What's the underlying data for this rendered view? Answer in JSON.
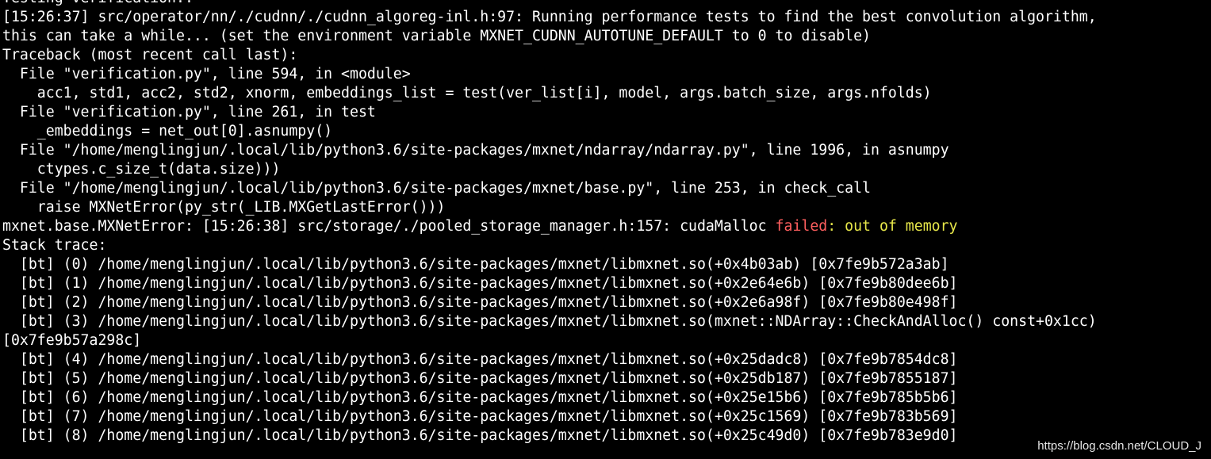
{
  "terminal": {
    "lines": [
      "Testing verification..",
      "[15:26:37] src/operator/nn/./cudnn/./cudnn_algoreg-inl.h:97: Running performance tests to find the best convolution algorithm,",
      "this can take a while... (set the environment variable MXNET_CUDNN_AUTOTUNE_DEFAULT to 0 to disable)",
      "Traceback (most recent call last):",
      "  File \"verification.py\", line 594, in <module>",
      "    acc1, std1, acc2, std2, xnorm, embeddings_list = test(ver_list[i], model, args.batch_size, args.nfolds)",
      "  File \"verification.py\", line 261, in test",
      "    _embeddings = net_out[0].asnumpy()",
      "  File \"/home/menglingjun/.local/lib/python3.6/site-packages/mxnet/ndarray/ndarray.py\", line 1996, in asnumpy",
      "    ctypes.c_size_t(data.size)))",
      "  File \"/home/menglingjun/.local/lib/python3.6/site-packages/mxnet/base.py\", line 253, in check_call",
      "    raise MXNetError(py_str(_LIB.MXGetLastError()))"
    ],
    "error_line": {
      "prefix": "mxnet.base.MXNetError: [15:26:38] src/storage/./pooled_storage_manager.h:157: cudaMalloc ",
      "failed": "failed",
      "suffix": ": out of memory"
    },
    "stack_lines": [
      "Stack trace:",
      "  [bt] (0) /home/menglingjun/.local/lib/python3.6/site-packages/mxnet/libmxnet.so(+0x4b03ab) [0x7fe9b572a3ab]",
      "  [bt] (1) /home/menglingjun/.local/lib/python3.6/site-packages/mxnet/libmxnet.so(+0x2e64e6b) [0x7fe9b80dee6b]",
      "  [bt] (2) /home/menglingjun/.local/lib/python3.6/site-packages/mxnet/libmxnet.so(+0x2e6a98f) [0x7fe9b80e498f]",
      "  [bt] (3) /home/menglingjun/.local/lib/python3.6/site-packages/mxnet/libmxnet.so(mxnet::NDArray::CheckAndAlloc() const+0x1cc)",
      "[0x7fe9b57a298c]",
      "  [bt] (4) /home/menglingjun/.local/lib/python3.6/site-packages/mxnet/libmxnet.so(+0x25dadc8) [0x7fe9b7854dc8]",
      "  [bt] (5) /home/menglingjun/.local/lib/python3.6/site-packages/mxnet/libmxnet.so(+0x25db187) [0x7fe9b7855187]",
      "  [bt] (6) /home/menglingjun/.local/lib/python3.6/site-packages/mxnet/libmxnet.so(+0x25e15b6) [0x7fe9b785b5b6]",
      "  [bt] (7) /home/menglingjun/.local/lib/python3.6/site-packages/mxnet/libmxnet.so(+0x25c1569) [0x7fe9b783b569]",
      "  [bt] (8) /home/menglingjun/.local/lib/python3.6/site-packages/mxnet/libmxnet.so(+0x25c49d0) [0x7fe9b783e9d0]"
    ]
  },
  "watermark": "https://blog.csdn.net/CLOUD_J",
  "colors": {
    "background": "#000000",
    "text": "#ffffff",
    "failed": "#ff5f5f",
    "out_of_memory": "#e8e84a"
  }
}
